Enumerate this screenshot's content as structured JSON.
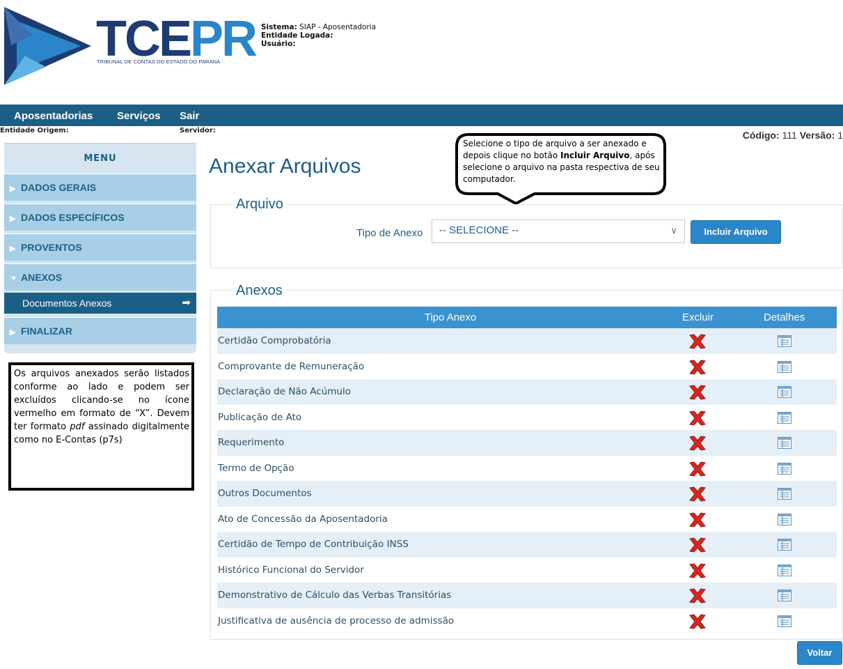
{
  "header": {
    "logo_main": "TCE",
    "logo_accent": "PR",
    "logo_subtitle": "TRIBUNAL DE CONTAS DO ESTADO DO PARANÁ",
    "sistema_label": "Sistema:",
    "sistema_value": "SIAP - Aposentadoria",
    "entidade_label": "Entidade Logada:",
    "usuario_label": "Usuário:"
  },
  "nav": {
    "items": [
      "Aposentadorias",
      "Serviços",
      "Sair"
    ]
  },
  "context": {
    "entidade_origem_label": "Entidade Origem:",
    "servidor_label": "Servidor:",
    "codigo_label": "Código:",
    "codigo_value": "111",
    "versao_label": "Versão:",
    "versao_value": "1"
  },
  "sidebar": {
    "menu_title": "MENU",
    "items": [
      {
        "label": "DADOS GERAIS",
        "arrow": "▶"
      },
      {
        "label": "DADOS ESPECÍFICOS",
        "arrow": "▶"
      },
      {
        "label": "PROVENTOS",
        "arrow": "▶"
      },
      {
        "label": "ANEXOS",
        "arrow": "▼"
      },
      {
        "label": "FINALIZAR",
        "arrow": "▶"
      }
    ],
    "sub_item": {
      "label": "Documentos Anexos",
      "arrow": "➡"
    }
  },
  "note": {
    "text_before": "Os arquivos anexados serão listados conforme ao lado e podem ser excluídos clicando-se no ícone vermelho em formato de “X”. Devem ter formato ",
    "text_em": "pdf",
    "text_after": " assinado digitalmente como no E-Contas (p7s)"
  },
  "page": {
    "title": "Anexar Arquivos"
  },
  "bubble": {
    "text_before": "Selecione o tipo de arquivo a ser anexado e depois clique no botão ",
    "text_bold": "Incluir Arquivo",
    "text_after": ", após selecione o arquivo na pasta respectiva de seu computador."
  },
  "arquivo": {
    "legend": "Arquivo",
    "tipo_label": "Tipo de Anexo",
    "select_value": "-- SELECIONE --",
    "incluir_button": "Incluir Arquivo"
  },
  "anexos": {
    "legend": "Anexos",
    "columns": [
      "Tipo Anexo",
      "Excluir",
      "Detalhes"
    ],
    "rows": [
      "Certidão Comprobatória",
      "Comprovante de Remuneração",
      "Declaração de Não Acúmulo",
      "Publicação de Ato",
      "Requerimento",
      "Termo de Opção",
      "Outros Documentos",
      "Ato de Concessão da Aposentadoria",
      "Certidão de Tempo de Contribuição INSS",
      "Histórico Funcional do Servidor",
      "Demonstrativo de Cálculo das Verbas Transitórias",
      "Justificativa de ausência de processo de admissão"
    ]
  },
  "footer": {
    "voltar_button": "Voltar"
  },
  "colors": {
    "nav_bg": "#1c5f86",
    "accent": "#2a86c9",
    "sidebar_bg": "#a9cfe7",
    "delete_red": "#d9261c"
  }
}
